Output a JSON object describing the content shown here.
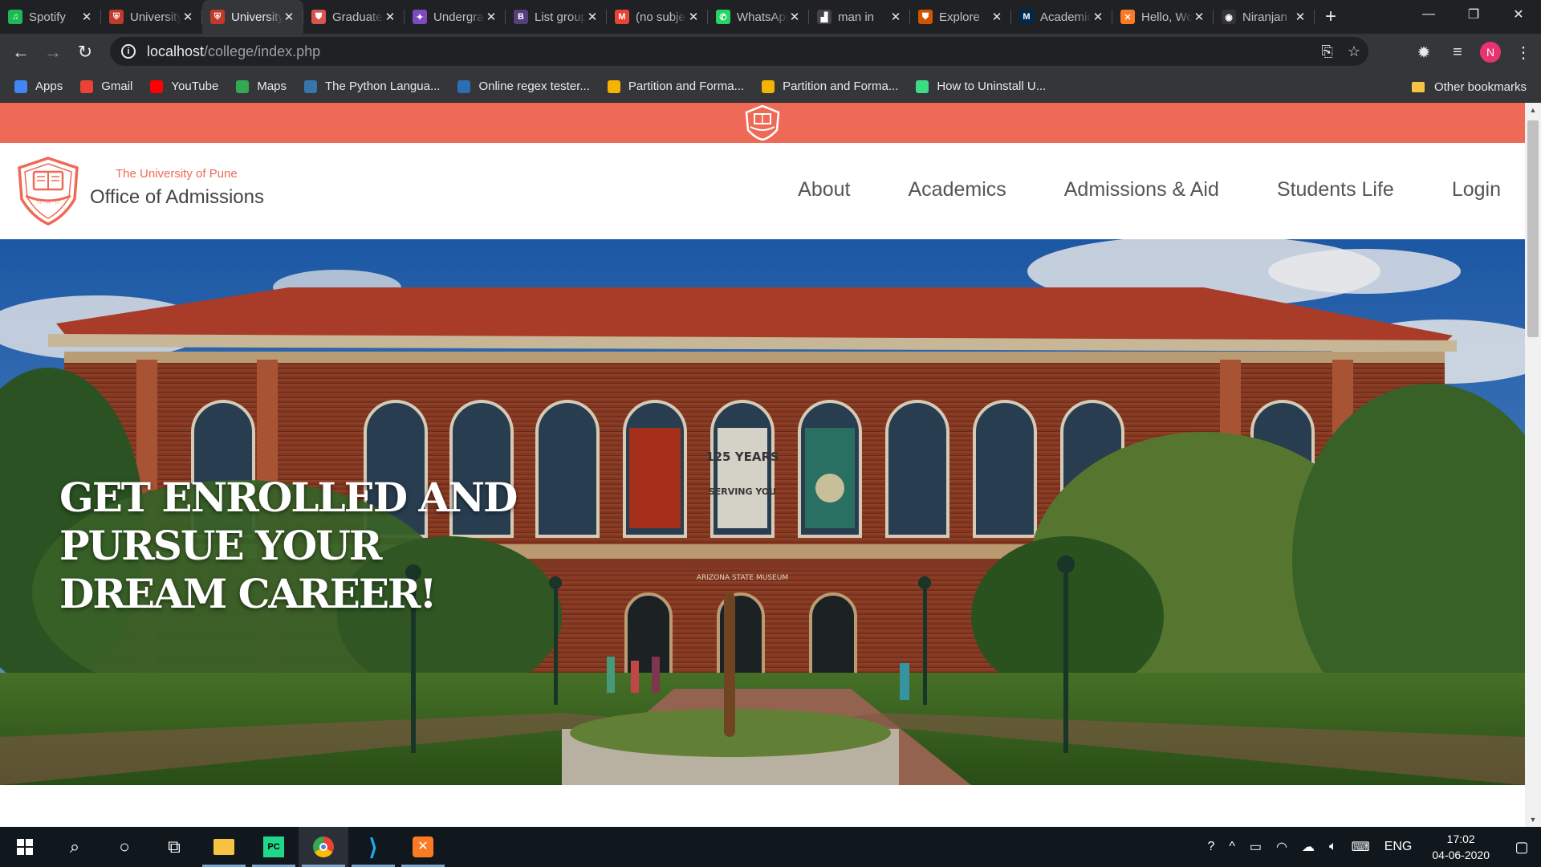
{
  "browser": {
    "tabs": [
      {
        "label": "Spotify",
        "icon": "spotify-icon",
        "color": "#1db954",
        "glyph": "♫"
      },
      {
        "label": "University",
        "icon": "crest-icon",
        "color": "#c0392b",
        "glyph": "⛨"
      },
      {
        "label": "University",
        "icon": "crest-icon",
        "color": "#c0392b",
        "glyph": "⛨"
      },
      {
        "label": "Graduate",
        "icon": "shield-icon",
        "color": "#d9534f",
        "glyph": "⛊"
      },
      {
        "label": "Undergraduate",
        "icon": "feather-icon",
        "color": "#7b4bbf",
        "glyph": "✦"
      },
      {
        "label": "List group",
        "icon": "bootstrap-icon",
        "color": "#563d7c",
        "glyph": "B"
      },
      {
        "label": "(no subject)",
        "icon": "gmail-icon",
        "color": "#ea4335",
        "glyph": "M"
      },
      {
        "label": "WhatsApp",
        "icon": "whatsapp-icon",
        "color": "#25d366",
        "glyph": "✆"
      },
      {
        "label": "man in",
        "icon": "image-icon",
        "color": "#444444",
        "glyph": "▟"
      },
      {
        "label": "Explore",
        "icon": "shield-icon",
        "color": "#d35400",
        "glyph": "⛊"
      },
      {
        "label": "Academics",
        "icon": "michigan-icon",
        "color": "#00274c",
        "glyph": "M"
      },
      {
        "label": "Hello, World",
        "icon": "xampp-icon",
        "color": "#fb7a24",
        "glyph": "✕"
      },
      {
        "label": "Niranjan",
        "icon": "github-icon",
        "color": "#333333",
        "glyph": "◉"
      }
    ],
    "active_tab_index": 2,
    "url_host": "localhost",
    "url_path": "/college/index.php",
    "bookmarks": [
      {
        "label": "Apps",
        "icon": "apps-grid-icon",
        "color": "#4285f4"
      },
      {
        "label": "Gmail",
        "icon": "gmail-icon",
        "color": "#ea4335"
      },
      {
        "label": "YouTube",
        "icon": "youtube-icon",
        "color": "#ff0000"
      },
      {
        "label": "Maps",
        "icon": "maps-pin-icon",
        "color": "#34a853"
      },
      {
        "label": "The Python Langua...",
        "icon": "python-icon",
        "color": "#3776ab"
      },
      {
        "label": "Online regex tester...",
        "icon": "regex-icon",
        "color": "#2d6db5"
      },
      {
        "label": "Partition and Forma...",
        "icon": "partition-icon",
        "color": "#f4b400"
      },
      {
        "label": "Partition and Forma...",
        "icon": "partition-icon",
        "color": "#f4b400"
      },
      {
        "label": "How to Uninstall U...",
        "icon": "android-icon",
        "color": "#3ddc84"
      }
    ],
    "other_bookmarks": "Other bookmarks",
    "profile_initial": "N"
  },
  "site": {
    "accent_color": "#ee6a57",
    "brand_sub": "The University of Pune",
    "brand_title": "Office of Admissions",
    "nav": [
      "About",
      "Academics",
      "Admissions & Aid",
      "Students Life",
      "Login"
    ],
    "hero_title": "GET ENROLLED AND PURSUE YOUR DREAM CAREER!",
    "hero_building_sign": "ARIZONA STATE MUSEUM",
    "banner_1": "125 YEARS",
    "banner_2": "SERVING YOU"
  },
  "taskbar": {
    "language": "ENG",
    "time": "17:02",
    "date": "04-06-2020"
  }
}
